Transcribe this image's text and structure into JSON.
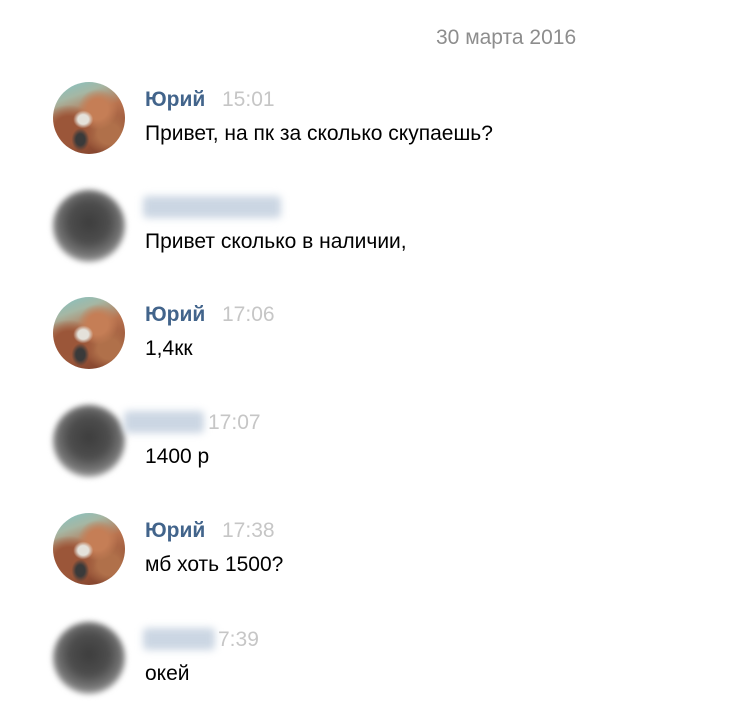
{
  "chat": {
    "date": "30 марта 2016",
    "messages": [
      {
        "author": "Юрий",
        "time": "15:01",
        "text": "Привет, на пк за сколько скупаешь?"
      },
      {
        "author": "",
        "time": "",
        "text": "Привет сколько в наличии,"
      },
      {
        "author": "Юрий",
        "time": "17:06",
        "text": "1,4кк"
      },
      {
        "author": "",
        "time": "17:07",
        "text": "1400 р"
      },
      {
        "author": "Юрий",
        "time": "17:38",
        "text": "мб хоть 1500?"
      },
      {
        "author": "",
        "time": "7:39",
        "text": "окей"
      }
    ]
  }
}
